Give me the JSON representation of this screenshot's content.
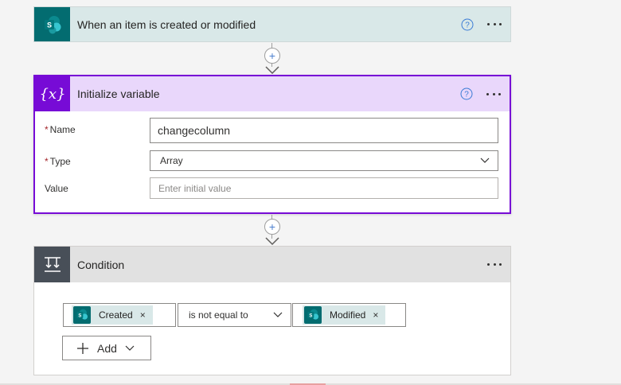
{
  "trigger": {
    "title": "When an item is created or modified",
    "icon": "sharepoint-icon",
    "accent": "#036c70"
  },
  "variable": {
    "title": "Initialize variable",
    "icon": "variable-icon",
    "accent": "#770bd6",
    "glyph": "{x}",
    "fields": {
      "name_label": "Name",
      "name_value": "changecolumn",
      "type_label": "Type",
      "type_value": "Array",
      "value_label": "Value",
      "value_placeholder": "Enter initial value"
    },
    "required_mark": "*"
  },
  "condition": {
    "title": "Condition",
    "icon": "condition-icon",
    "accent": "#484f58",
    "left_token": "Created",
    "operator": "is not equal to",
    "right_token": "Modified",
    "add_label": "Add",
    "close_glyph": "×"
  },
  "connector": {
    "add_glyph": "+"
  }
}
